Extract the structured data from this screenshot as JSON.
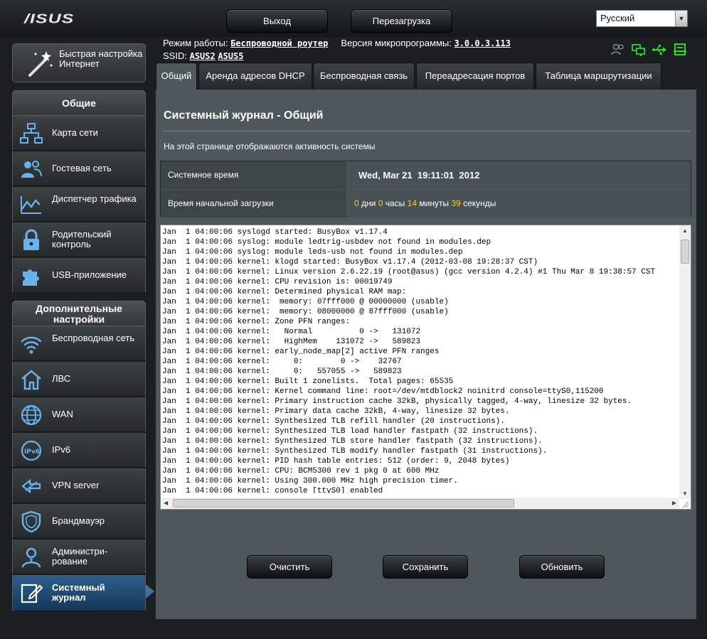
{
  "header": {
    "logo": "/ISUS",
    "logout_label": "Выход",
    "reboot_label": "Перезагрузка",
    "language": "Русский"
  },
  "info": {
    "mode_label": "Режим работы:",
    "mode_value": "Беспроводной роутер",
    "firmware_label": "Версия микропрограммы:",
    "firmware_value": "3.0.0.3.113",
    "ssid_label": "SSID:",
    "ssid_1": "ASUS2",
    "ssid_2": "ASUS5"
  },
  "sidebar": {
    "quick_setup": "Быстрая настройка Интернет",
    "general_header": "Общие",
    "advanced_header": "Дополнительные настройки",
    "general_items": [
      {
        "label": "Карта сети"
      },
      {
        "label": "Гостевая сеть"
      },
      {
        "label": "Диспетчер трафика"
      },
      {
        "label": "Родительский контроль"
      },
      {
        "label": "USB-приложение"
      }
    ],
    "advanced_items": [
      {
        "label": "Беспроводная сеть"
      },
      {
        "label": "ЛВС"
      },
      {
        "label": "WAN"
      },
      {
        "label": "IPv6"
      },
      {
        "label": "VPN server"
      },
      {
        "label": "Брандмауэр"
      },
      {
        "label": "Администри-рование"
      },
      {
        "label": "Системный журнал"
      }
    ]
  },
  "tabs": [
    {
      "label": "Общий"
    },
    {
      "label": "Аренда адресов DHCP"
    },
    {
      "label": "Беспроводная связь"
    },
    {
      "label": "Переадресация портов"
    },
    {
      "label": "Таблица маршрутизации"
    }
  ],
  "main": {
    "title": "Системный журнал - Общий",
    "description": "На этой странице отображаются активность системы",
    "system_time_label": "Системное время",
    "system_time_value": "Wed, Mar 21  19:11:01  2012",
    "uptime_label": "Время начальной загрузки",
    "uptime": {
      "days": "0",
      "days_unit": "дни",
      "hours": "0",
      "hours_unit": "часы",
      "minutes": "14",
      "minutes_unit": "минуты",
      "seconds": "39",
      "seconds_unit": "секунды"
    },
    "log_lines": [
      "Jan  1 04:00:06 syslogd started: BusyBox v1.17.4",
      "Jan  1 04:00:06 syslog: module ledtrig-usbdev not found in modules.dep",
      "Jan  1 04:00:06 syslog: module leds-usb not found in modules.dep",
      "Jan  1 04:00:06 kernel: klogd started: BusyBox v1.17.4 (2012-03-08 19:28:37 CST)",
      "Jan  1 04:00:06 kernel: Linux version 2.6.22.19 (root@asus) (gcc version 4.2.4) #1 Thu Mar 8 19:38:57 CST",
      "Jan  1 04:00:06 kernel: CPU revision is: 00019749",
      "Jan  1 04:00:06 kernel: Determined physical RAM map:",
      "Jan  1 04:00:06 kernel:  memory: 07fff000 @ 00000000 (usable)",
      "Jan  1 04:00:06 kernel:  memory: 08000000 @ 87fff000 (usable)",
      "Jan  1 04:00:06 kernel: Zone PFN ranges:",
      "Jan  1 04:00:06 kernel:   Normal          0 ->   131072",
      "Jan  1 04:00:06 kernel:   HighMem    131072 ->   589823",
      "Jan  1 04:00:06 kernel: early_node_map[2] active PFN ranges",
      "Jan  1 04:00:06 kernel:     0:        0 ->    32767",
      "Jan  1 04:00:06 kernel:     0:   557055 ->   589823",
      "Jan  1 04:00:06 kernel: Built 1 zonelists.  Total pages: 65535",
      "Jan  1 04:00:06 kernel: Kernel command line: root=/dev/mtdblock2 noinitrd console=ttyS0,115200",
      "Jan  1 04:00:06 kernel: Primary instruction cache 32kB, physically tagged, 4-way, linesize 32 bytes.",
      "Jan  1 04:00:06 kernel: Primary data cache 32kB, 4-way, linesize 32 bytes.",
      "Jan  1 04:00:06 kernel: Synthesized TLB refill handler (20 instructions).",
      "Jan  1 04:00:06 kernel: Synthesized TLB load handler fastpath (32 instructions).",
      "Jan  1 04:00:06 kernel: Synthesized TLB store handler fastpath (32 instructions).",
      "Jan  1 04:00:06 kernel: Synthesized TLB modify handler fastpath (31 instructions).",
      "Jan  1 04:00:06 kernel: PID hash table entries: 512 (order: 9, 2048 bytes)",
      "Jan  1 04:00:06 kernel: CPU: BCM5300 rev 1 pkg 0 at 600 MHz",
      "Jan  1 04:00:06 kernel: Using 300.000 MHz high precision timer.",
      "Jan  1 04:00:06 kernel: console [ttyS0] enabled"
    ],
    "clear_label": "Очистить",
    "save_label": "Сохранить",
    "refresh_label": "Обновить"
  },
  "colors": {
    "accent_yellow": "#ffcc00",
    "active_nav": "#2d5f8c",
    "status_green": "#22dd22"
  }
}
